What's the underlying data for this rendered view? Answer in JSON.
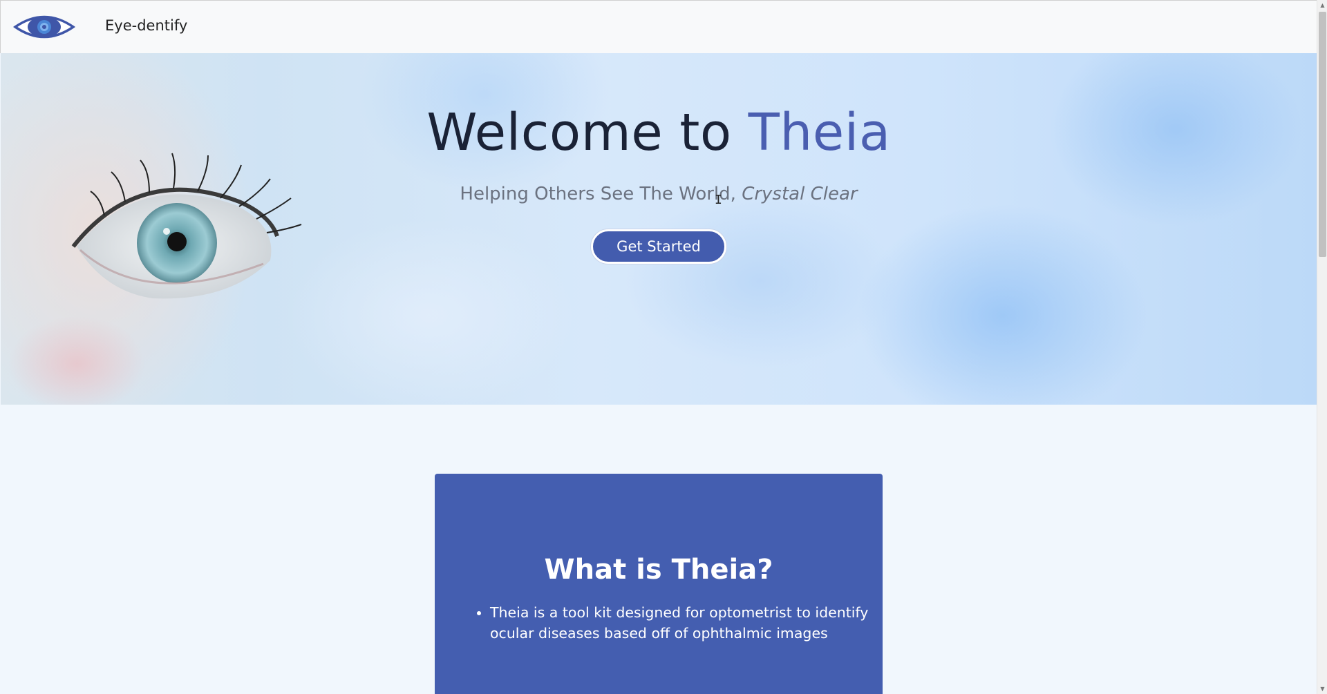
{
  "navbar": {
    "logo_icon": "eye-logo-icon",
    "brand": "Eye-dentify"
  },
  "hero": {
    "title_prefix": "Welcome to ",
    "title_accent": "Theia",
    "subtitle_plain": "Helping Others See The World, ",
    "subtitle_italic": "Crystal Clear",
    "cta_label": "Get Started"
  },
  "about": {
    "title": "What is Theia?",
    "items": [
      "Theia is a tool kit designed for optometrist to identify ocular diseases based off of ophthalmic images"
    ]
  },
  "colors": {
    "primary": "#445eb0",
    "accent_text": "#4a5eb0",
    "title_text": "#1a2236",
    "subtitle_text": "#6b7280",
    "page_bg": "#f1f7fd",
    "navbar_bg": "#f8f9fa"
  }
}
